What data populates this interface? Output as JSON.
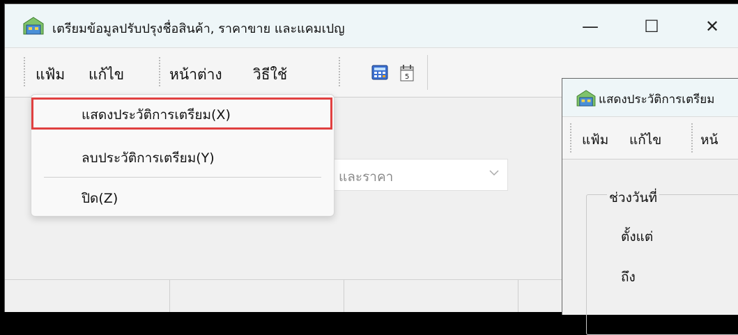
{
  "main_window": {
    "title": "เตรียมข้อมูลปรับปรุงชื่อสินค้า, ราคาขาย และแคมเปญ",
    "controls": {
      "minimize": "—",
      "maximize": "☐",
      "close": "✕"
    },
    "menu": {
      "file": "แฟ้ม",
      "edit": "แก้ไข",
      "window": "หน้าต่าง",
      "help": "วิธีใช้"
    },
    "toolbar_icons": [
      "calculator-icon",
      "calendar-icon"
    ],
    "combo": {
      "value": "และราคา"
    },
    "dropdown": {
      "items": [
        {
          "label": "แสดงประวัติการเตรียม(X)",
          "highlighted": true
        },
        {
          "label": "ลบประวัติการเตรียม(Y)"
        },
        {
          "label": "ปิด(Z)"
        }
      ]
    }
  },
  "second_window": {
    "title": "แสดงประวัติการเตรียม",
    "menu": {
      "file": "แฟ้ม",
      "edit": "แก้ไข",
      "window_partial": "หน้"
    },
    "group": {
      "label": "ช่วงวันที่",
      "from_label": "ตั้งแต่",
      "to_label": "ถึง"
    }
  },
  "colors": {
    "highlight_border": "#e04040",
    "titlebar": "#eef6f8"
  }
}
